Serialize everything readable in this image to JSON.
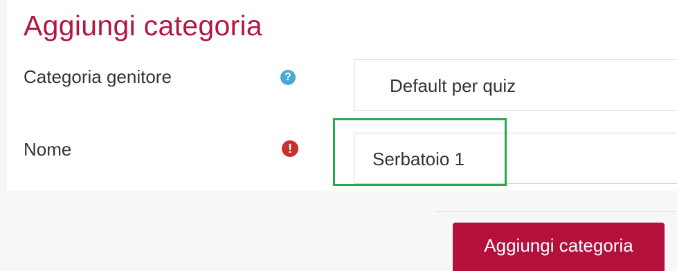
{
  "form": {
    "title": "Aggiungi categoria",
    "parent_category": {
      "label": "Categoria genitore",
      "help_icon": "question-circle-icon",
      "help_icon_glyph": "?",
      "value": "Default per quiz"
    },
    "name": {
      "label": "Nome",
      "required_icon": "exclamation-circle-icon",
      "required_icon_glyph": "!",
      "value": "Serbatoio 1"
    },
    "submit_label": "Aggiungi categoria"
  },
  "colors": {
    "accent": "#b5163f",
    "button": "#b3103c",
    "help": "#4aa8d8",
    "required": "#c9302c",
    "highlight": "#2aa84a"
  }
}
